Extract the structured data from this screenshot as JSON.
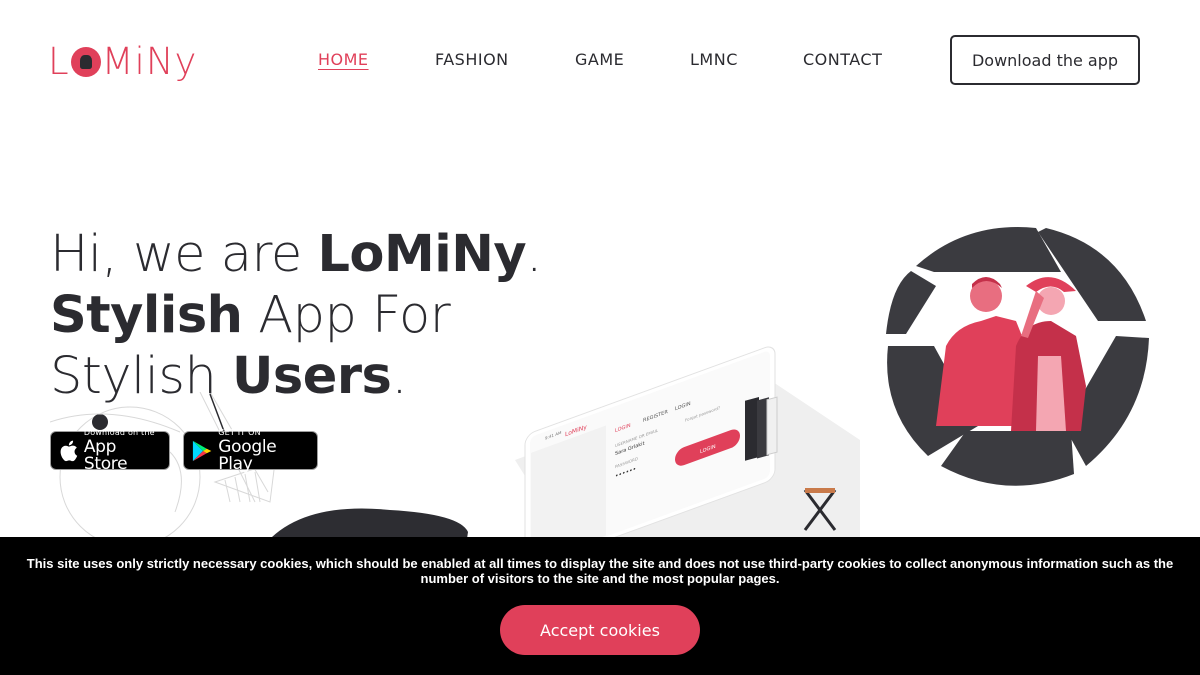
{
  "brand": {
    "logo_text_l": "L",
    "logo_text_rest": "MiNy",
    "accent_color": "#e0405a",
    "dark_color": "#2b2b30"
  },
  "nav": {
    "items": [
      {
        "label": "HOME",
        "active": true
      },
      {
        "label": "FASHION",
        "active": false
      },
      {
        "label": "GAME",
        "active": false
      },
      {
        "label": "LMNC",
        "active": false
      },
      {
        "label": "CONTACT",
        "active": false
      }
    ],
    "download_label": "Download the app"
  },
  "hero": {
    "line1_prefix": "Hi, we are ",
    "line1_bold": "LoMiNy",
    "line1_suffix": ".",
    "line2_bold": "Stylish",
    "line2_rest": " App For",
    "line3_prefix": "Stylish ",
    "line3_bold": "Users",
    "line3_suffix": "."
  },
  "stores": {
    "apple_small": "Download on the",
    "apple_big": "App Store",
    "apple_icon": "apple-icon",
    "google_small": "GET IT ON",
    "google_big": "Google Play",
    "google_icon": "google-play-icon"
  },
  "phone": {
    "tab_login": "LOGIN",
    "tab_register": "REGISTER",
    "tab_fb": "LOGIN",
    "field_user_label": "USERNAME OR EMAIL",
    "field_user_value": "Sara Grlakit",
    "field_pass_label": "PASSWORD",
    "forgot": "Forgot password?",
    "button": "LOGIN",
    "time": "9:41 AM"
  },
  "cookie": {
    "text": "This site uses only strictly necessary cookies, which should be enabled at all times to display the site and does not use third-party cookies to collect anonymous information such as the number of visitors to the site and the most popular pages.",
    "accept_label": "Accept cookies"
  }
}
